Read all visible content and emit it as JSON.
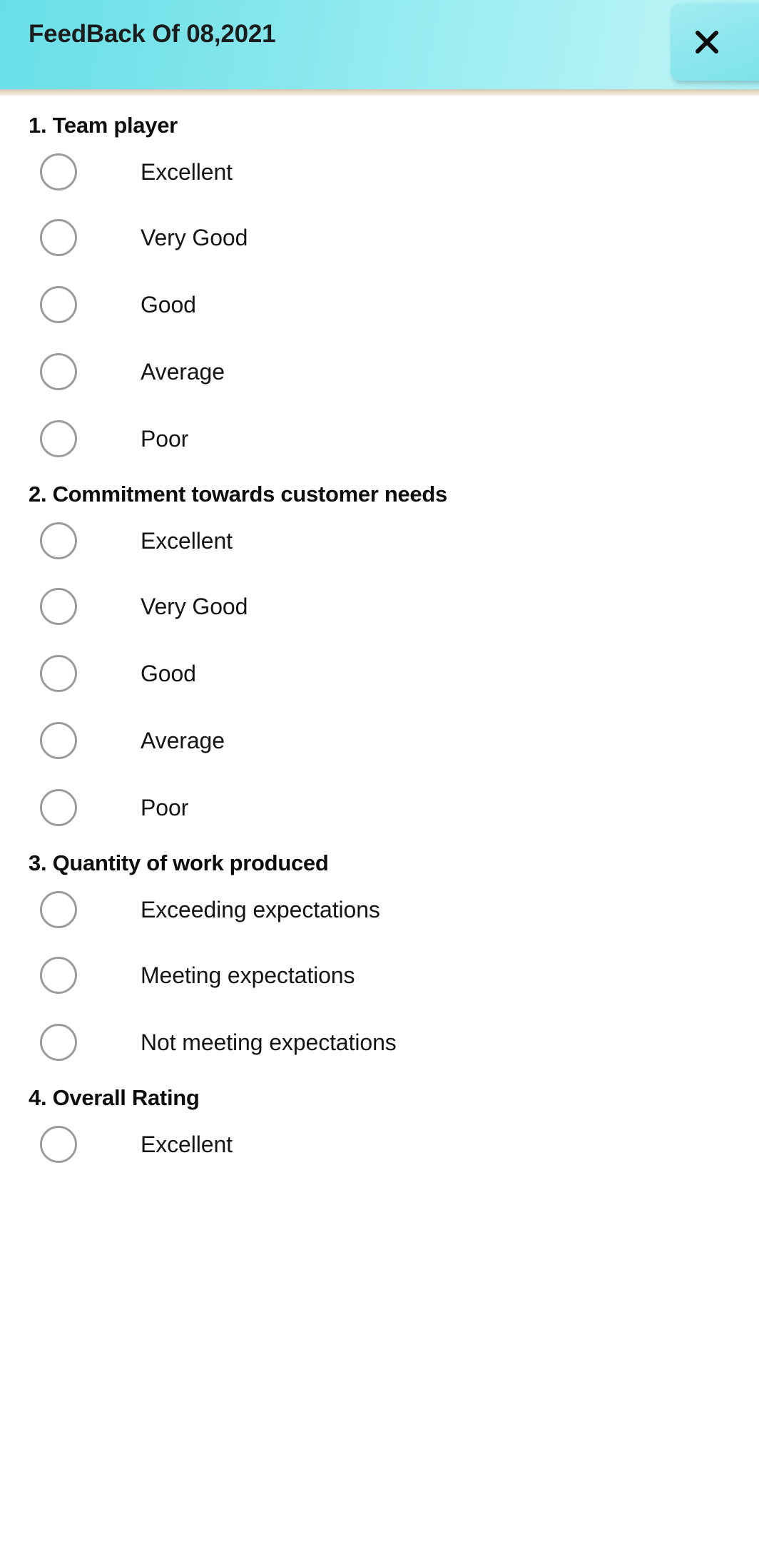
{
  "header": {
    "title": "FeedBack Of 08,2021",
    "close_label": "×",
    "close_icon": "close-icon",
    "gradient_left": "#68dfe8",
    "gradient_right": "#a9eff2"
  },
  "separator": {
    "color": "#e6dac6"
  },
  "colors": {
    "radio_outline": "#9b9b9b",
    "text": "#141414",
    "heading": "#0d0d0d",
    "background": "#ffffff"
  },
  "questions": [
    {
      "title": "1. Team player",
      "options": [
        {
          "label": "Excellent",
          "selected": false
        },
        {
          "label": "Very Good",
          "selected": false
        },
        {
          "label": "Good",
          "selected": false
        },
        {
          "label": "Average",
          "selected": false
        },
        {
          "label": "Poor",
          "selected": false
        }
      ]
    },
    {
      "title": "2. Commitment towards customer needs",
      "options": [
        {
          "label": "Excellent",
          "selected": false
        },
        {
          "label": "Very Good",
          "selected": false
        },
        {
          "label": "Good",
          "selected": false
        },
        {
          "label": "Average",
          "selected": false
        },
        {
          "label": "Poor",
          "selected": false
        }
      ]
    },
    {
      "title": "3. Quantity of work produced",
      "options": [
        {
          "label": "Exceeding expectations",
          "selected": false
        },
        {
          "label": "Meeting expectations",
          "selected": false
        },
        {
          "label": "Not meeting expectations",
          "selected": false
        }
      ]
    },
    {
      "title": "4. Overall Rating",
      "options": [
        {
          "label": "Excellent",
          "selected": false
        }
      ]
    }
  ]
}
